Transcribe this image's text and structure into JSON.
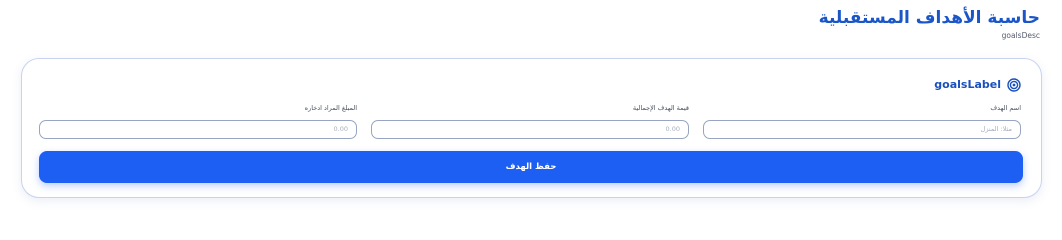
{
  "header": {
    "title": "حاسبة الأهداف المستقبلية",
    "description": "goalsDesc"
  },
  "card": {
    "title": "goalsLabel",
    "icon": "target-icon",
    "fields": {
      "name": {
        "label": "اسم الهدف",
        "placeholder": "مثلا: المنزل",
        "value": ""
      },
      "total": {
        "label": "قيمة الهدف الإجمالية",
        "placeholder": "0.00",
        "value": ""
      },
      "saved": {
        "label": "المبلغ المراد ادخاره",
        "placeholder": "0.00",
        "value": ""
      }
    },
    "save_label": "حفظ الهدف"
  },
  "colors": {
    "accent": "#1d5ff2",
    "title": "#1a56c8",
    "border": "#c8d3f1"
  }
}
